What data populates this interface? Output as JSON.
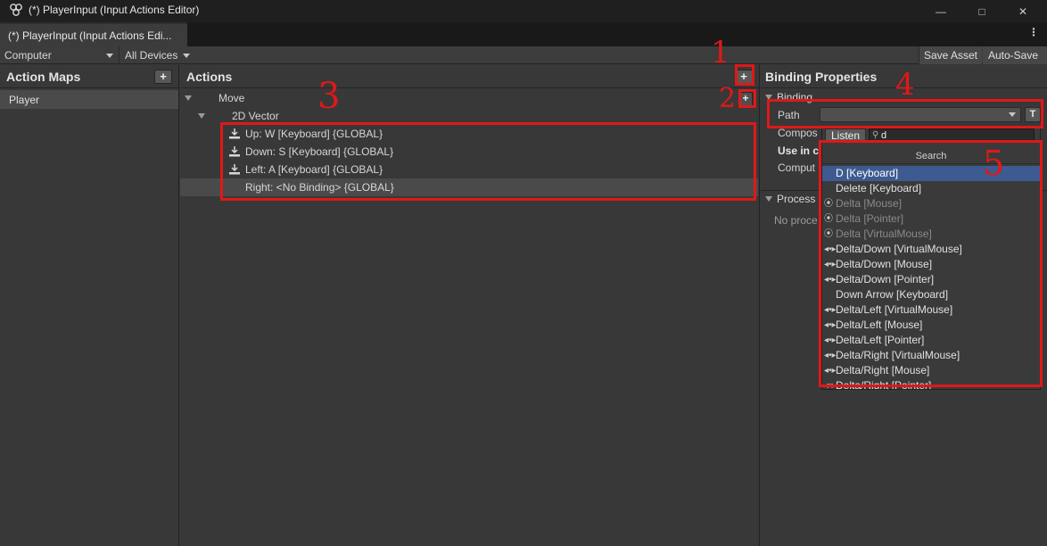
{
  "window": {
    "title": "(*) PlayerInput (Input Actions Editor)",
    "controls": {
      "minimize": "—",
      "maximize": "□",
      "close": "✕"
    }
  },
  "tabs": [
    {
      "label": "(*) PlayerInput (Input Actions Edi..."
    }
  ],
  "tab_menu_glyph": "⋮",
  "toolbar": {
    "control_scheme": "Computer",
    "devices": "All Devices",
    "save_asset": "Save Asset",
    "auto_save": "Auto-Save"
  },
  "action_maps": {
    "title": "Action Maps",
    "add_glyph": "+",
    "items": [
      {
        "label": "Player"
      }
    ]
  },
  "actions": {
    "title": "Actions",
    "add_glyph": "+",
    "move": "Move",
    "composite": "2D Vector",
    "bindings": [
      {
        "label": "Up: W [Keyboard] {GLOBAL}"
      },
      {
        "label": "Down: S [Keyboard] {GLOBAL}"
      },
      {
        "label": "Left: A [Keyboard] {GLOBAL}"
      },
      {
        "label": "Right: <No Binding> {GLOBAL}"
      }
    ]
  },
  "binding_properties": {
    "title": "Binding Properties",
    "binding_section": "Binding",
    "path_label": "Path",
    "t_button": "T",
    "compos_label": "Compos",
    "use_in_label": "Use in c",
    "comput_label": "Comput",
    "processors_label": "Process",
    "no_processors_label": "No proce"
  },
  "search_popup": {
    "listen_button": "Listen",
    "search_value": "d",
    "search_icon": "magnifier-icon",
    "title": "Search",
    "results": [
      {
        "label": "D [Keyboard]",
        "icon": "",
        "selected": true,
        "dim": false
      },
      {
        "label": "Delete [Keyboard]",
        "icon": "",
        "selected": false,
        "dim": false
      },
      {
        "label": "Delta [Mouse]",
        "icon": "⦿",
        "selected": false,
        "dim": true
      },
      {
        "label": "Delta [Pointer]",
        "icon": "⦿",
        "selected": false,
        "dim": true
      },
      {
        "label": "Delta [VirtualMouse]",
        "icon": "⦿",
        "selected": false,
        "dim": true
      },
      {
        "label": "Delta/Down [VirtualMouse]",
        "icon": "◂•▸",
        "selected": false,
        "dim": false
      },
      {
        "label": "Delta/Down [Mouse]",
        "icon": "◂•▸",
        "selected": false,
        "dim": false
      },
      {
        "label": "Delta/Down [Pointer]",
        "icon": "◂•▸",
        "selected": false,
        "dim": false
      },
      {
        "label": "Down Arrow [Keyboard]",
        "icon": "",
        "selected": false,
        "dim": false
      },
      {
        "label": "Delta/Left [VirtualMouse]",
        "icon": "◂•▸",
        "selected": false,
        "dim": false
      },
      {
        "label": "Delta/Left [Mouse]",
        "icon": "◂•▸",
        "selected": false,
        "dim": false
      },
      {
        "label": "Delta/Left [Pointer]",
        "icon": "◂•▸",
        "selected": false,
        "dim": false
      },
      {
        "label": "Delta/Right [VirtualMouse]",
        "icon": "◂•▸",
        "selected": false,
        "dim": false
      },
      {
        "label": "Delta/Right [Mouse]",
        "icon": "◂•▸",
        "selected": false,
        "dim": false
      },
      {
        "label": "Delta/Right [Pointer]",
        "icon": "◂•▸",
        "selected": false,
        "dim": false
      }
    ]
  },
  "annotations": {
    "color": "#e01818",
    "numbers": [
      "1",
      "2",
      "3",
      "4",
      "5"
    ]
  }
}
